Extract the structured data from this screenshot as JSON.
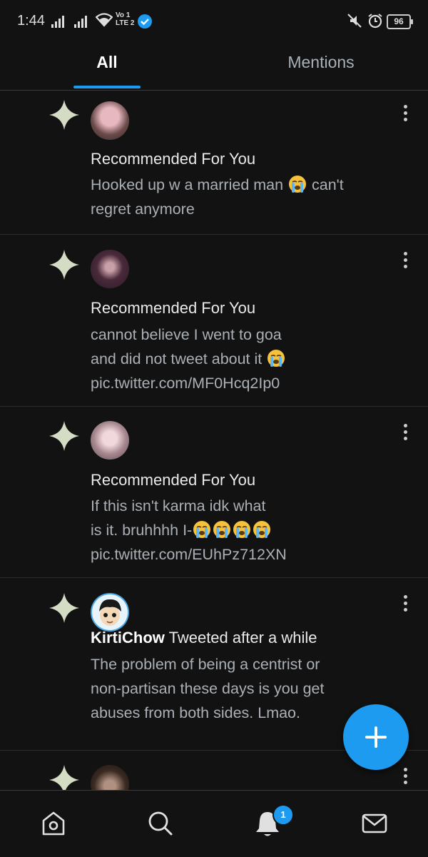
{
  "status_bar": {
    "time": "1:44",
    "network": "Vo LTE 2",
    "battery": "96"
  },
  "tabs": [
    {
      "label": "All",
      "selected": true
    },
    {
      "label": "Mentions",
      "selected": false
    }
  ],
  "notifications": [
    {
      "headline": "Recommended For You",
      "lines": [
        "Hooked up w a married man 😭 can't",
        "regret anymore"
      ]
    },
    {
      "headline": "Recommended For You",
      "lines": [
        "cannot believe I went to goa",
        "and did not tweet about it 😭",
        "pic.twitter.com/MF0Hcq2Ip0"
      ]
    },
    {
      "headline": "Recommended For You",
      "lines": [
        "If this isn't karma idk what",
        "is it. bruhhhh I-😭😭😭😭",
        "pic.twitter.com/EUhPz712XN"
      ]
    },
    {
      "user": "KirtiChow",
      "headline_suffix": "Tweeted after a while",
      "lines": [
        "The problem of being a centrist or",
        "non-partisan these days is you get",
        "abuses from both sides. Lmao."
      ]
    }
  ],
  "bottom_nav": {
    "items": [
      "home-icon",
      "search-icon",
      "notifications-icon",
      "messages-icon"
    ],
    "notification_badge": "1"
  },
  "colors": {
    "accent": "#1d9bf0",
    "background": "#121212",
    "sparkle": "#d4dcc4",
    "secondary_text": "#aab0b6"
  }
}
